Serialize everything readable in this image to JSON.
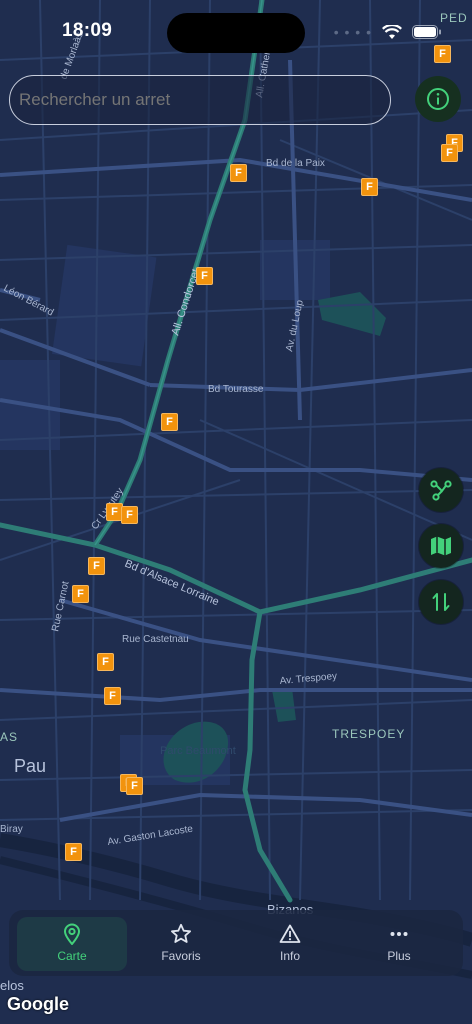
{
  "status_bar": {
    "time": "18:09",
    "dots": "• • • •"
  },
  "search": {
    "placeholder": "Rechercher un arret"
  },
  "map": {
    "labels": {
      "bd_de_la_paix": "Bd de la Paix",
      "all_condorcet": "All. Condorcet",
      "av_du_loup": "Av. du Loup",
      "bd_tourasse": "Bd Tourasse",
      "leon_berard": "Léon Bérard",
      "cr_lyautey": "Cr Lyautey",
      "bd_alsace_lorraine": "Bd d'Alsace Lorraine",
      "rue_carnot": "Rue Carnot",
      "rue_castetnau": "Rue Castetnau",
      "av_trespoey": "Av. Trespoey",
      "trespoey": "TRESPOEY",
      "pau": "Pau",
      "as": "AS",
      "parc_beaumont": "Parc Beaumont",
      "biray": "Biray",
      "av_gaston_lacoste": "Av. Gaston Lacoste",
      "bizanos": "Bizanos",
      "ped": "PED",
      "all_catherine": "All. Catherine",
      "de_morlaas": "de Morlaàs",
      "elos": "elos"
    },
    "marker_letter": "F",
    "colors": {
      "background": "#1f2d4f",
      "roads": "#33497a",
      "tram": "#2e7d76",
      "park": "#1d5159",
      "marker": "#f2930d"
    }
  },
  "map_controls": {
    "info": "info-icon",
    "routes": "route-network-icon",
    "map": "map-icon",
    "swap": "swap-vertical-icon"
  },
  "tabs": [
    {
      "label": "Carte",
      "icon": "map-pin-icon",
      "active": true
    },
    {
      "label": "Favoris",
      "icon": "star-icon",
      "active": false
    },
    {
      "label": "Info",
      "icon": "warning-icon",
      "active": false
    },
    {
      "label": "Plus",
      "icon": "more-icon",
      "active": false
    }
  ],
  "attribution": "Google",
  "accent_color": "#43d17b"
}
